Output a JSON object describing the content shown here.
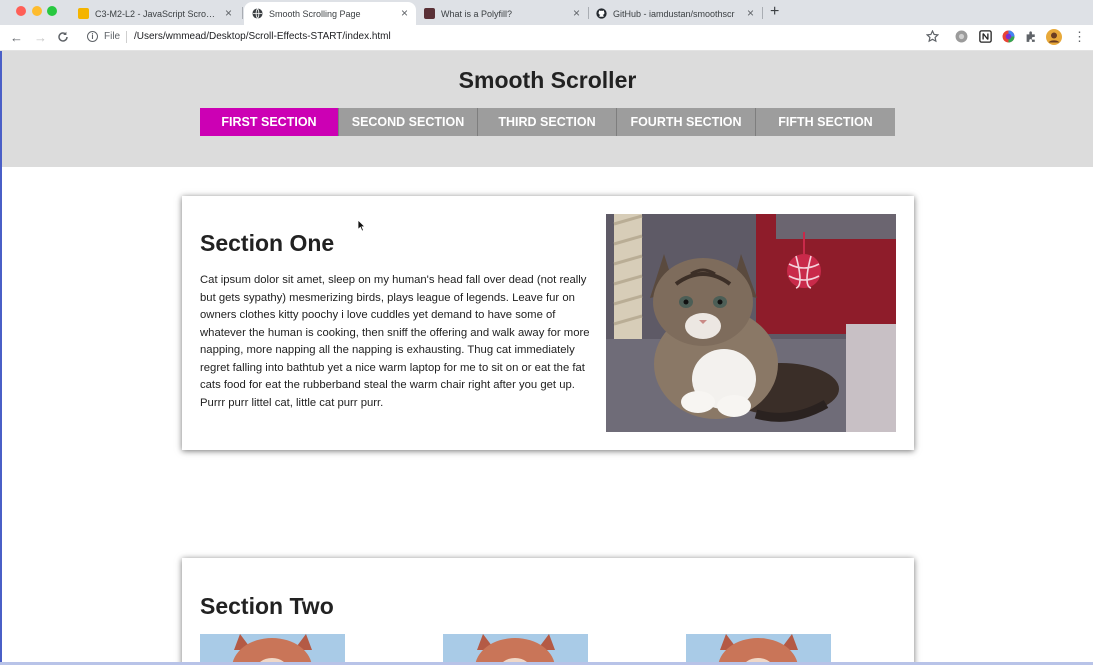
{
  "browser": {
    "tabs": [
      {
        "title": "C3-M2-L2 - JavaScript Scroll E",
        "active": false,
        "favicon": "slides-icon"
      },
      {
        "title": "Smooth Scrolling Page",
        "active": true,
        "favicon": "globe-icon"
      },
      {
        "title": "What is a Polyfill?",
        "active": false,
        "favicon": "site-icon"
      },
      {
        "title": "GitHub - iamdustan/smoothscr",
        "active": false,
        "favicon": "github-icon"
      }
    ],
    "address": {
      "scheme_label": "File",
      "url": "/Users/wmmead/Desktop/Scroll-Effects-START/index.html"
    }
  },
  "page": {
    "title": "Smooth Scroller",
    "nav": [
      {
        "label": "First Section",
        "active": true
      },
      {
        "label": "Second Section",
        "active": false
      },
      {
        "label": "Third Section",
        "active": false
      },
      {
        "label": "Fourth Section",
        "active": false
      },
      {
        "label": "Fifth Section",
        "active": false
      }
    ],
    "sections": [
      {
        "heading": "Section One",
        "text": "Cat ipsum dolor sit amet, sleep on my human's head fall over dead (not really but gets sypathy) mesmerizing birds, plays league of legends. Leave fur on owners clothes kitty poochy i love cuddles yet demand to have some of whatever the human is cooking, then sniff the offering and walk away for more napping, more napping all the napping is exhausting. Thug cat immediately regret falling into bathtub yet a nice warm laptop for me to sit on or eat the fat cats food for eat the rubberband steal the warm chair right after you get up. Purrr purr littel cat, little cat purr purr."
      },
      {
        "heading": "Section Two"
      }
    ]
  },
  "colors": {
    "accent": "#cc00b4",
    "nav_inactive": "#9d9d9d",
    "header_bg": "#dcdcdc"
  }
}
